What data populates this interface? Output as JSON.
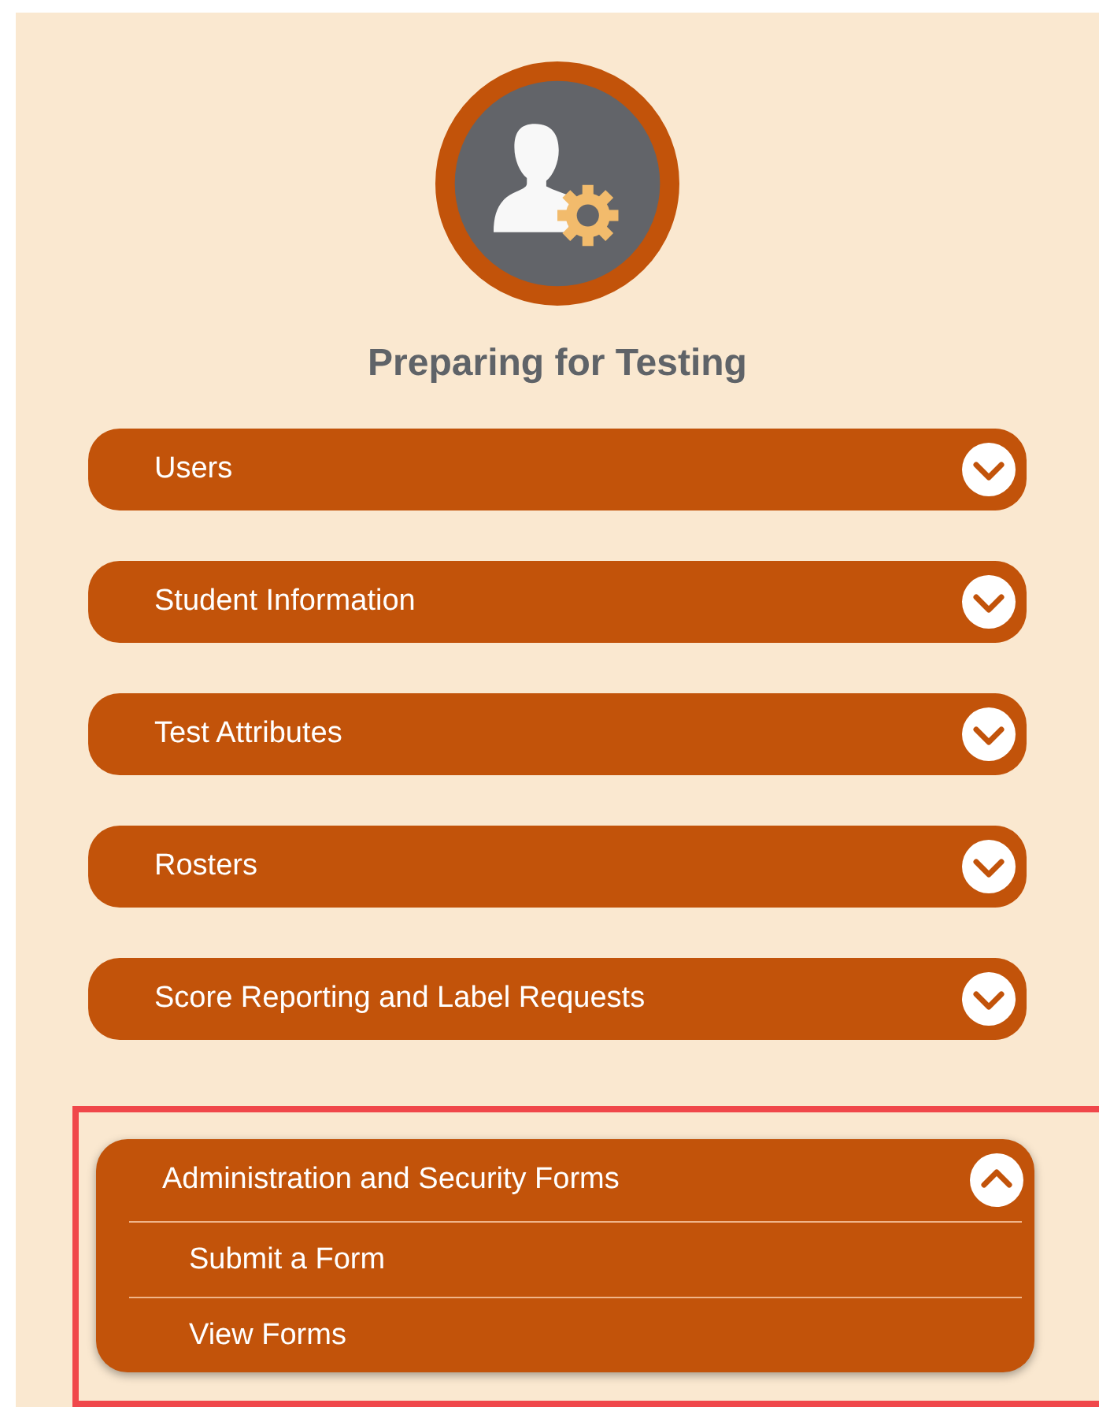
{
  "title": "Preparing for Testing",
  "sections": [
    {
      "label": "Users",
      "expanded": false,
      "highlighted": false
    },
    {
      "label": "Student Information",
      "expanded": false,
      "highlighted": false
    },
    {
      "label": "Test Attributes",
      "expanded": false,
      "highlighted": false
    },
    {
      "label": "Rosters",
      "expanded": false,
      "highlighted": false
    },
    {
      "label": "Score Reporting and Label Requests",
      "expanded": false,
      "highlighted": false
    },
    {
      "label": "Administration and Security Forms",
      "expanded": true,
      "highlighted": true,
      "children": [
        {
          "label": "Submit a Form"
        },
        {
          "label": "View Forms"
        }
      ]
    }
  ]
}
